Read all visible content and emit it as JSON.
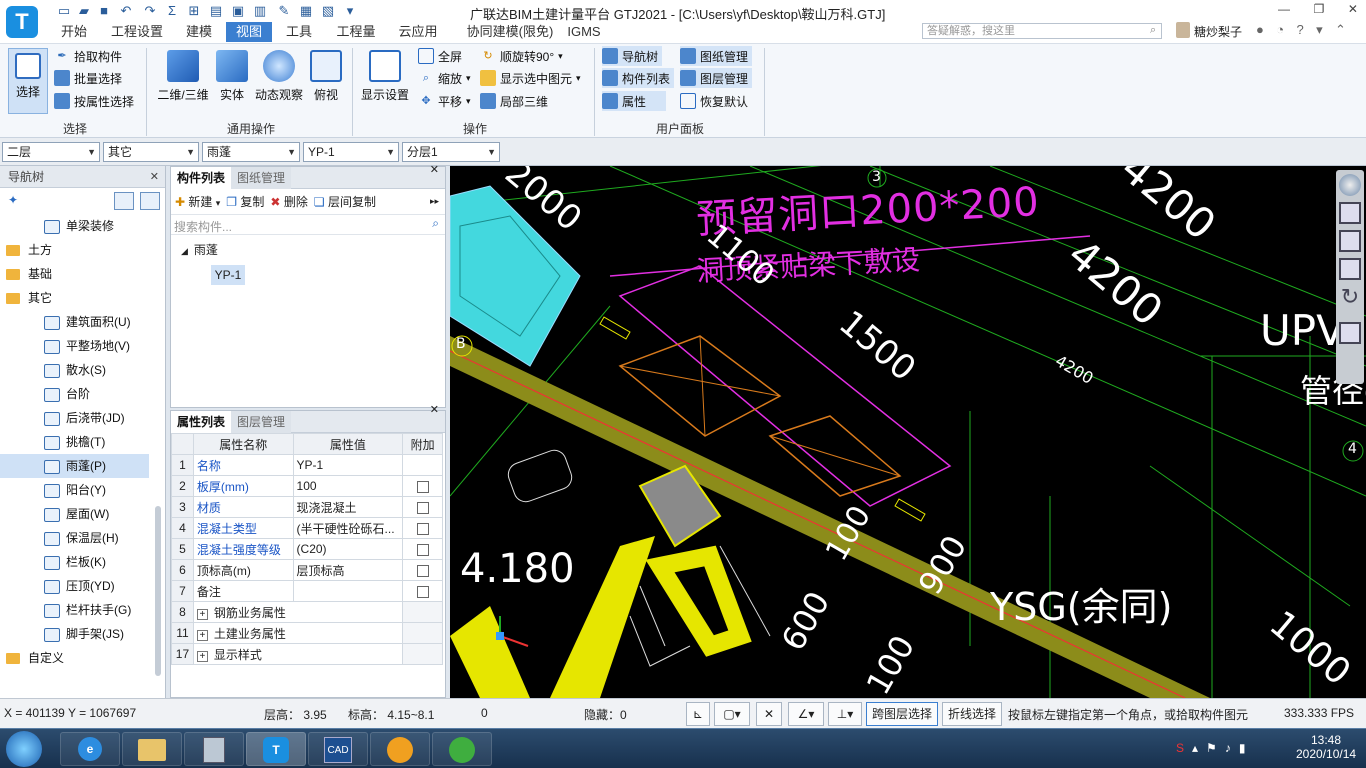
{
  "app": {
    "title": "广联达BIM土建计量平台 GTJ2021 - [C:\\Users\\yf\\Desktop\\鞍山万科.GTJ]",
    "menu": [
      "开始",
      "工程设置",
      "建模",
      "视图",
      "工具",
      "工程量",
      "云应用",
      "协同建模(限免)",
      "IGMS"
    ],
    "active_menu": "视图",
    "search_placeholder": "答疑解惑，搜这里",
    "user": "糖炒梨子"
  },
  "ribbon": {
    "select": {
      "pick": "拾取构件",
      "batch": "批量选择",
      "by_attr": "按属性选择",
      "select": "选择",
      "group": "选择"
    },
    "general": {
      "v2d3d": "二维/三维",
      "solid": "实体",
      "dynamic": "动态观察",
      "top": "俯视",
      "group": "通用操作"
    },
    "ops": {
      "display": "显示设置",
      "full": "全屏",
      "zoom": "缩放",
      "pan": "平移",
      "rotate": "顺旋转90°",
      "show_sel": "显示选中图元",
      "local3d": "局部三维",
      "group": "操作"
    },
    "user_panel": {
      "nav": "导航树",
      "drawing": "图纸管理",
      "comp": "构件列表",
      "layer": "图层管理",
      "attr": "属性",
      "restore": "恢复默认",
      "group": "用户面板"
    }
  },
  "selectors": {
    "floor": "二层",
    "type": "其它",
    "category": "雨蓬",
    "component": "YP-1",
    "sublayer": "分层1"
  },
  "nav": {
    "title": "导航树",
    "items": [
      {
        "label": "单梁装修",
        "kind": "child"
      },
      {
        "label": "土方",
        "kind": "folder"
      },
      {
        "label": "基础",
        "kind": "folder"
      },
      {
        "label": "其它",
        "kind": "folder"
      },
      {
        "label": "建筑面积(U)",
        "kind": "child"
      },
      {
        "label": "平整场地(V)",
        "kind": "child"
      },
      {
        "label": "散水(S)",
        "kind": "child"
      },
      {
        "label": "台阶",
        "kind": "child"
      },
      {
        "label": "后浇带(JD)",
        "kind": "child"
      },
      {
        "label": "挑檐(T)",
        "kind": "child"
      },
      {
        "label": "雨蓬(P)",
        "kind": "child"
      },
      {
        "label": "阳台(Y)",
        "kind": "child"
      },
      {
        "label": "屋面(W)",
        "kind": "child"
      },
      {
        "label": "保温层(H)",
        "kind": "child"
      },
      {
        "label": "栏板(K)",
        "kind": "child"
      },
      {
        "label": "压顶(YD)",
        "kind": "child"
      },
      {
        "label": "栏杆扶手(G)",
        "kind": "child"
      },
      {
        "label": "脚手架(JS)",
        "kind": "child"
      },
      {
        "label": "自定义",
        "kind": "folder"
      }
    ]
  },
  "complist": {
    "tabs": [
      "构件列表",
      "图纸管理"
    ],
    "toolbar": {
      "new": "新建",
      "copy": "复制",
      "delete": "删除",
      "floor_copy": "层间复制"
    },
    "search_placeholder": "搜索构件...",
    "tree_root": "雨蓬",
    "tree_child": "YP-1"
  },
  "proplist": {
    "tabs": [
      "属性列表",
      "图层管理"
    ],
    "headers": [
      "属性名称",
      "属性值",
      "附加"
    ],
    "rows": [
      {
        "n": "1",
        "name": "名称",
        "value": "YP-1",
        "blue": true,
        "chk": false
      },
      {
        "n": "2",
        "name": "板厚(mm)",
        "value": "100",
        "blue": true,
        "chk": true
      },
      {
        "n": "3",
        "name": "材质",
        "value": "现浇混凝土",
        "blue": true,
        "chk": true
      },
      {
        "n": "4",
        "name": "混凝土类型",
        "value": "(半干硬性砼砾石...",
        "blue": true,
        "chk": true
      },
      {
        "n": "5",
        "name": "混凝土强度等级",
        "value": "(C20)",
        "blue": true,
        "chk": true
      },
      {
        "n": "6",
        "name": "顶标高(m)",
        "value": "层顶标高",
        "blue": false,
        "chk": true
      },
      {
        "n": "7",
        "name": "备注",
        "value": "",
        "blue": false,
        "chk": true
      },
      {
        "n": "8",
        "name": "钢筋业务属性",
        "value": "",
        "blue": false,
        "chk": false,
        "group": true
      },
      {
        "n": "11",
        "name": "土建业务属性",
        "value": "",
        "blue": false,
        "chk": false,
        "group": true
      },
      {
        "n": "17",
        "name": "显示样式",
        "value": "",
        "blue": false,
        "chk": false,
        "group": true
      }
    ]
  },
  "canvas_text": {
    "note1": "预留洞口200*200",
    "note2": "洞顶紧贴梁下敷设",
    "d2000": "2000",
    "d4200a": "4200",
    "d4200b": "4200",
    "d4200c": "4200",
    "d1500": "1500",
    "d1100": "1100",
    "d100a": "100",
    "d900": "900",
    "d600": "600",
    "d100b": "100",
    "d1000": "1000",
    "elev": "4.180",
    "ysg": "YSG(余同)",
    "upv": "UPV",
    "pipe": "管径φ",
    "axis3": "3",
    "axis4": "4",
    "axisB": "B"
  },
  "status": {
    "coords": "X = 401139 Y = 1067697",
    "floor_h": "层高： 3.95",
    "elev": "标高： 4.15~8.1",
    "zero": "0",
    "hidden": "隐藏：0",
    "cross_layer": "跨图层选择",
    "polyline": "折线选择",
    "hint": "按鼠标左键指定第一个角点，或拾取构件图元",
    "fps": "333.333 FPS"
  },
  "taskbar": {
    "time": "13:48",
    "date": "2020/10/14"
  },
  "colors": {
    "accent": "#3b7fd0",
    "canvas": "#000000",
    "beam_yellow": "#e6e600",
    "magenta": "#e22fe2",
    "cyan": "#4fe3e8"
  }
}
